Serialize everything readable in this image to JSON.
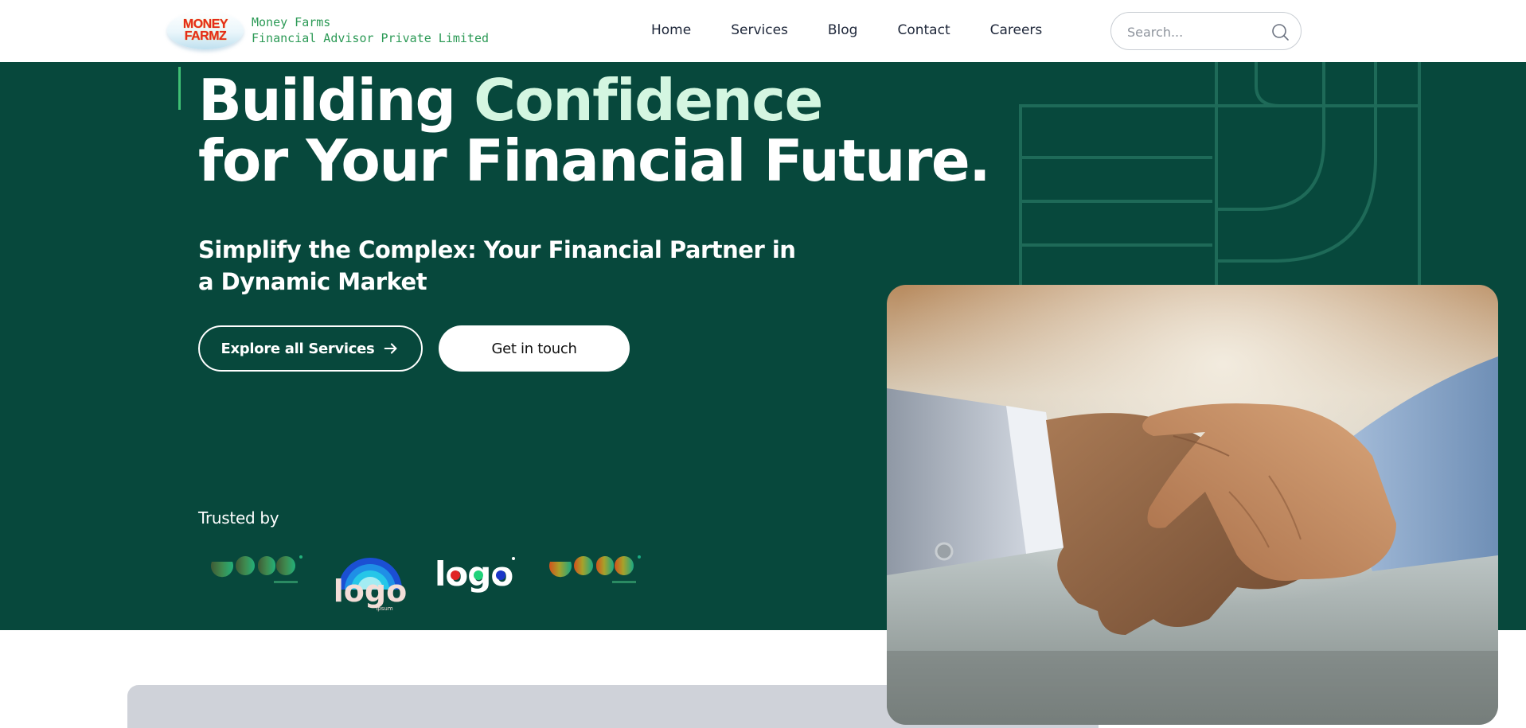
{
  "header": {
    "logo": {
      "line1": "MONEY",
      "line2": "FARMZ"
    },
    "brand_name": "Money Farms",
    "brand_tagline": "Financial Advisor Private Limited",
    "nav": [
      {
        "label": "Home"
      },
      {
        "label": "Services"
      },
      {
        "label": "Blog"
      },
      {
        "label": "Contact"
      },
      {
        "label": "Careers"
      }
    ],
    "search": {
      "placeholder": "Search...",
      "value": "",
      "icon": "search-icon"
    }
  },
  "hero": {
    "title_part1": "Building",
    "title_highlight": "Confidence",
    "title_line2": "for Your Financial Future.",
    "subtitle": "Simplify the Complex: Your Financial Partner in a Dynamic Market",
    "primary_button": "Explore all Services",
    "primary_button_icon": "arrow-right-icon",
    "secondary_button": "Get in touch",
    "trusted_label": "Trusted by",
    "partner_logos": [
      {
        "name": "logo-ipsum-gradient-1"
      },
      {
        "name": "logo-ipsum-rainbow",
        "text": "logo",
        "subtext": "ipsum"
      },
      {
        "name": "logo-dots",
        "text": "logo"
      },
      {
        "name": "logo-ipsum-gradient-2"
      }
    ],
    "image": "handshake-photo"
  },
  "colors": {
    "hero_bg": "#07483c",
    "accent_green": "#3fbf74",
    "highlight": "#d4f6e1",
    "brand_text": "#2c9a56",
    "nav_text": "#1d2639",
    "card_gray": "#cfd2d9"
  }
}
